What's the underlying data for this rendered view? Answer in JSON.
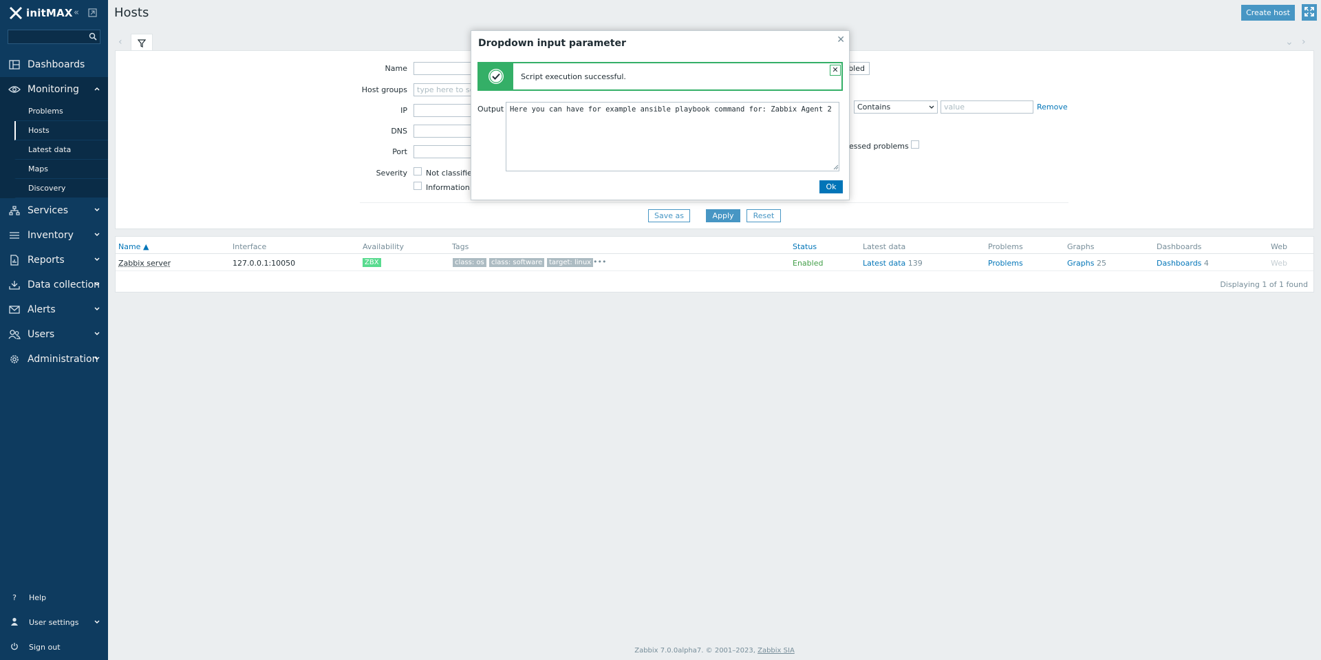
{
  "sidebar": {
    "brand": "initMAX",
    "search_value": "",
    "menu": [
      {
        "label": "Dashboards",
        "icon": "dashboards-icon"
      },
      {
        "label": "Monitoring",
        "icon": "eye-icon"
      },
      {
        "label": "Services",
        "icon": "services-icon"
      },
      {
        "label": "Inventory",
        "icon": "list-icon"
      },
      {
        "label": "Reports",
        "icon": "reports-icon"
      },
      {
        "label": "Data collection",
        "icon": "download-icon"
      },
      {
        "label": "Alerts",
        "icon": "mail-icon"
      },
      {
        "label": "Users",
        "icon": "users-icon"
      },
      {
        "label": "Administration",
        "icon": "gear-icon"
      }
    ],
    "monitoring_sub": [
      {
        "label": "Problems"
      },
      {
        "label": "Hosts"
      },
      {
        "label": "Latest data"
      },
      {
        "label": "Maps"
      },
      {
        "label": "Discovery"
      }
    ],
    "bottom": [
      {
        "label": "Help",
        "icon": "help-icon"
      },
      {
        "label": "User settings",
        "icon": "user-icon"
      },
      {
        "label": "Sign out",
        "icon": "power-icon"
      }
    ]
  },
  "header": {
    "title": "Hosts",
    "create_button": "Create host"
  },
  "filter": {
    "name_label": "Name",
    "host_groups_label": "Host groups",
    "host_groups_placeholder": "type here to sea",
    "ip_label": "IP",
    "dns_label": "DNS",
    "port_label": "Port",
    "severity_label": "Severity",
    "sev_not_classified": "Not classified",
    "sev_information": "Information",
    "status_fragment": "bled",
    "tag_operator": "Contains",
    "tag_value_placeholder": "value",
    "remove_link": "Remove",
    "suppressed_fragment": "essed problems",
    "save_as": "Save as",
    "apply": "Apply",
    "reset": "Reset"
  },
  "table": {
    "headers": {
      "name": "Name ▲",
      "interface": "Interface",
      "availability": "Availability",
      "tags": "Tags",
      "status": "Status",
      "latest_data": "Latest data",
      "problems": "Problems",
      "graphs": "Graphs",
      "dashboards": "Dashboards",
      "web": "Web"
    },
    "row": {
      "name": "Zabbix server",
      "interface": "127.0.0.1:10050",
      "availability": "ZBX",
      "tags": [
        "class: os",
        "class: software",
        "target: linux"
      ],
      "tags_more": "•••",
      "status": "Enabled",
      "latest_data": "Latest data",
      "latest_data_count": "139",
      "problems": "Problems",
      "graphs": "Graphs",
      "graphs_count": "25",
      "dashboards": "Dashboards",
      "dashboards_count": "4",
      "web": "Web"
    },
    "footer": "Displaying 1 of 1 found"
  },
  "dialog": {
    "title": "Dropdown input parameter",
    "message": "Script execution successful.",
    "output_label": "Output",
    "output_text": "Here you can have for example ansible playbook command for: Zabbix Agent 2",
    "ok_button": "Ok"
  },
  "footer": {
    "text": "Zabbix 7.0.0alpha7. © 2001–2023, ",
    "link": "Zabbix SIA"
  },
  "colors": {
    "sidebar": "#0e3b5f",
    "accent": "#4796c4",
    "success": "#34af67",
    "link": "#0275b8",
    "enabled": "#429e47",
    "zbx_available": "#59db8f"
  }
}
